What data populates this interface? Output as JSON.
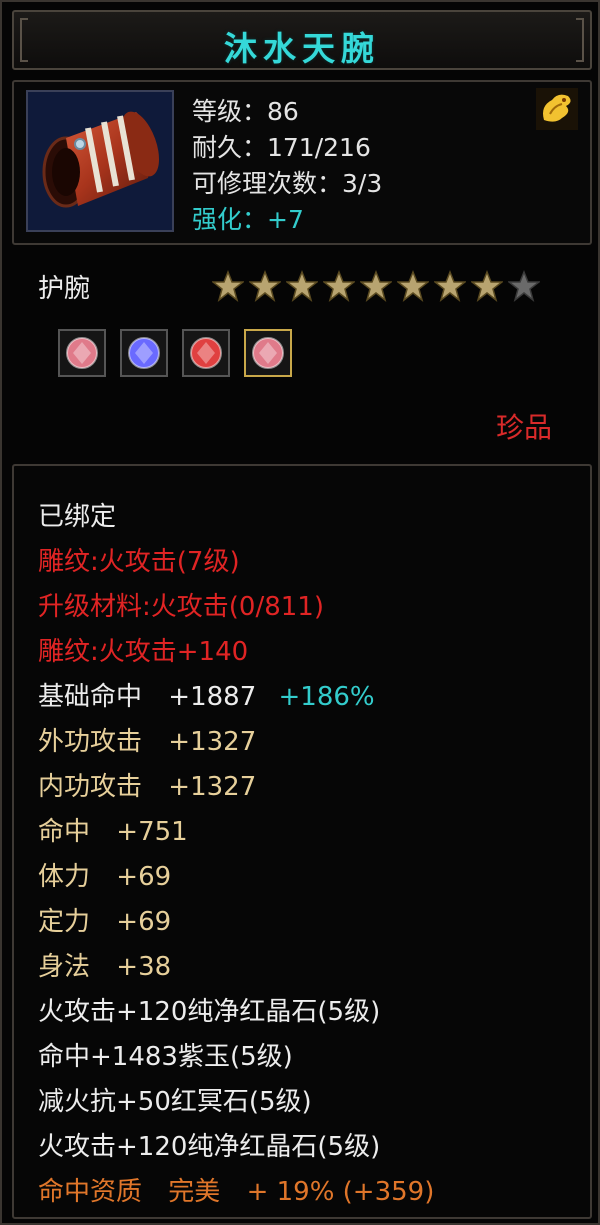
{
  "title": "沐水天腕",
  "item": {
    "icon": "bracer-icon",
    "level_label": "等级：86",
    "durability_label": "耐久：171/216",
    "repairs_label": "可修理次数：3/3",
    "enhance_label": "强化：+7",
    "badge_icon": "golden-dragon-icon"
  },
  "type_label": "护腕",
  "stars": {
    "filled": 8,
    "total": 9
  },
  "gems": [
    {
      "name": "pure-red-crystal-gem-icon",
      "color": "#e07a8a"
    },
    {
      "name": "purple-jade-gem-icon",
      "color": "#6a6aff"
    },
    {
      "name": "red-ming-stone-gem-icon",
      "color": "#e04040"
    },
    {
      "name": "pure-red-crystal-gem-icon",
      "color": "#e07a8a"
    }
  ],
  "quality": "珍品",
  "attributes": {
    "bound": "已绑定",
    "engrave_level": "雕纹:火攻击(7级)",
    "upgrade_material": "升级材料:火攻击(0/811)",
    "engrave_bonus": "雕纹:火攻击+140",
    "base_hit_label": "基础命中",
    "base_hit_value": "+1887",
    "base_hit_pct": "+186%",
    "ext_attack_label": "外功攻击",
    "ext_attack_value": "+1327",
    "int_attack_label": "内功攻击",
    "int_attack_value": "+1327",
    "hit_label": "命中",
    "hit_value": "+751",
    "stamina_label": "体力",
    "stamina_value": "+69",
    "focus_label": "定力",
    "focus_value": "+69",
    "agility_label": "身法",
    "agility_value": "+38",
    "gem_line_1": "火攻击+120纯净红晶石(5级)",
    "gem_line_2": "命中+1483紫玉(5级)",
    "gem_line_3": "减火抗+50红冥石(5级)",
    "gem_line_4": "火攻击+120纯净红晶石(5级)",
    "aptitude_label": "命中资质",
    "aptitude_grade": "完美",
    "aptitude_value": "+ 19% (+359)"
  },
  "colors": {
    "title": "#35d8d8",
    "red": "#e02424",
    "gold": "#e6cf9a",
    "cyan": "#33cccc",
    "orange": "#e0762a"
  }
}
